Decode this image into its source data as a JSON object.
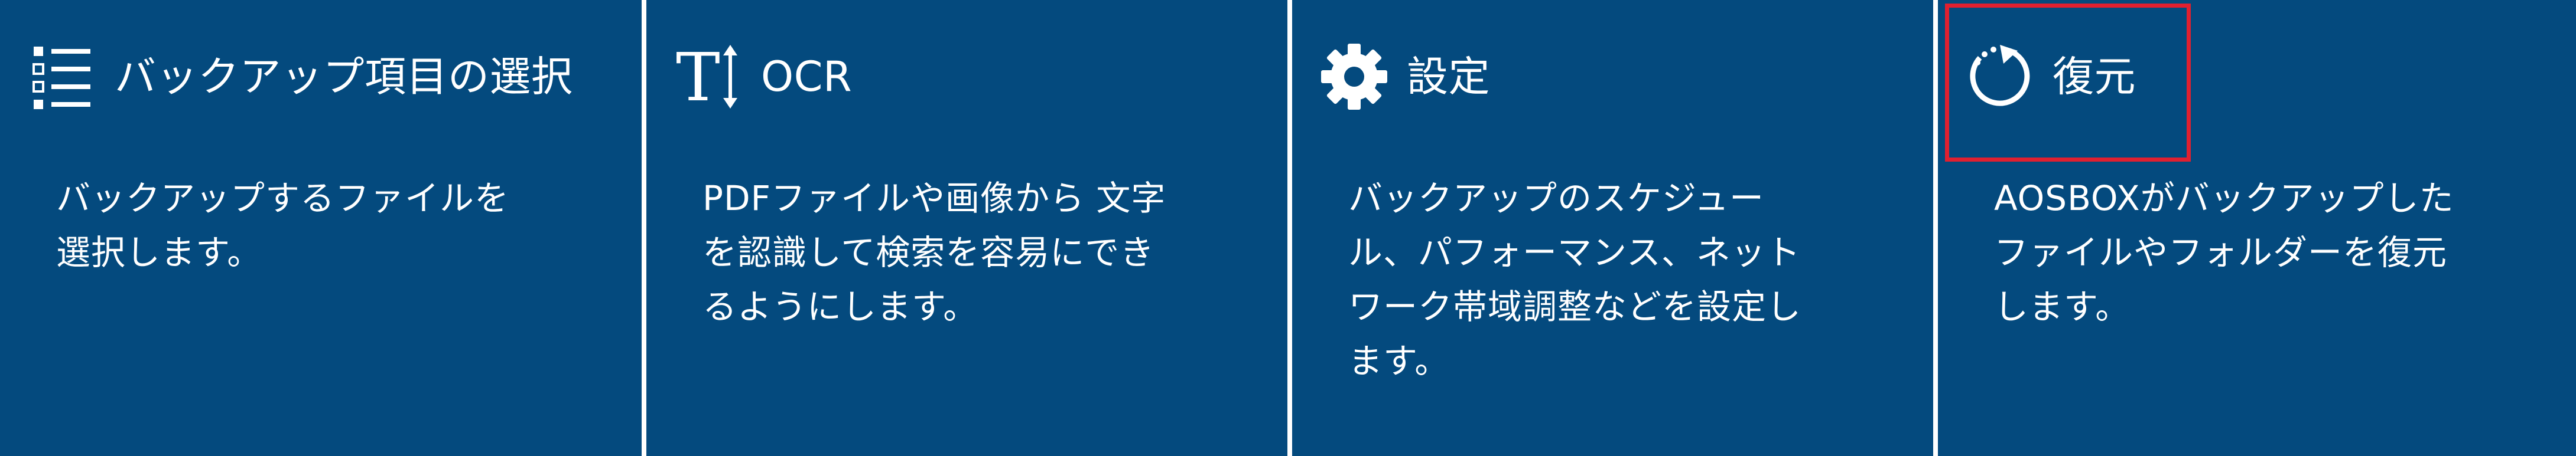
{
  "tiles": [
    {
      "title": "バックアップ項目の選択",
      "description": "バックアップするファイルを選択します。",
      "icon": "list-icon"
    },
    {
      "title": "OCR",
      "description": "PDFファイルや画像から 文字を認識して検索を容易にできるようにします。",
      "icon": "text-size-icon"
    },
    {
      "title": "設定",
      "description": "バックアップのスケジュール、パフォーマンス、ネットワーク帯域調整などを設定します。",
      "icon": "gear-icon"
    },
    {
      "title": "復元",
      "description": "AOSBOXがバックアップしたファイルやフォルダーを復元します。",
      "icon": "restore-icon",
      "highlighted": true
    }
  ],
  "colors": {
    "tile_background": "#044a7e",
    "text": "#ffffff",
    "divider": "#ffffff",
    "highlight_border": "#e02030"
  }
}
